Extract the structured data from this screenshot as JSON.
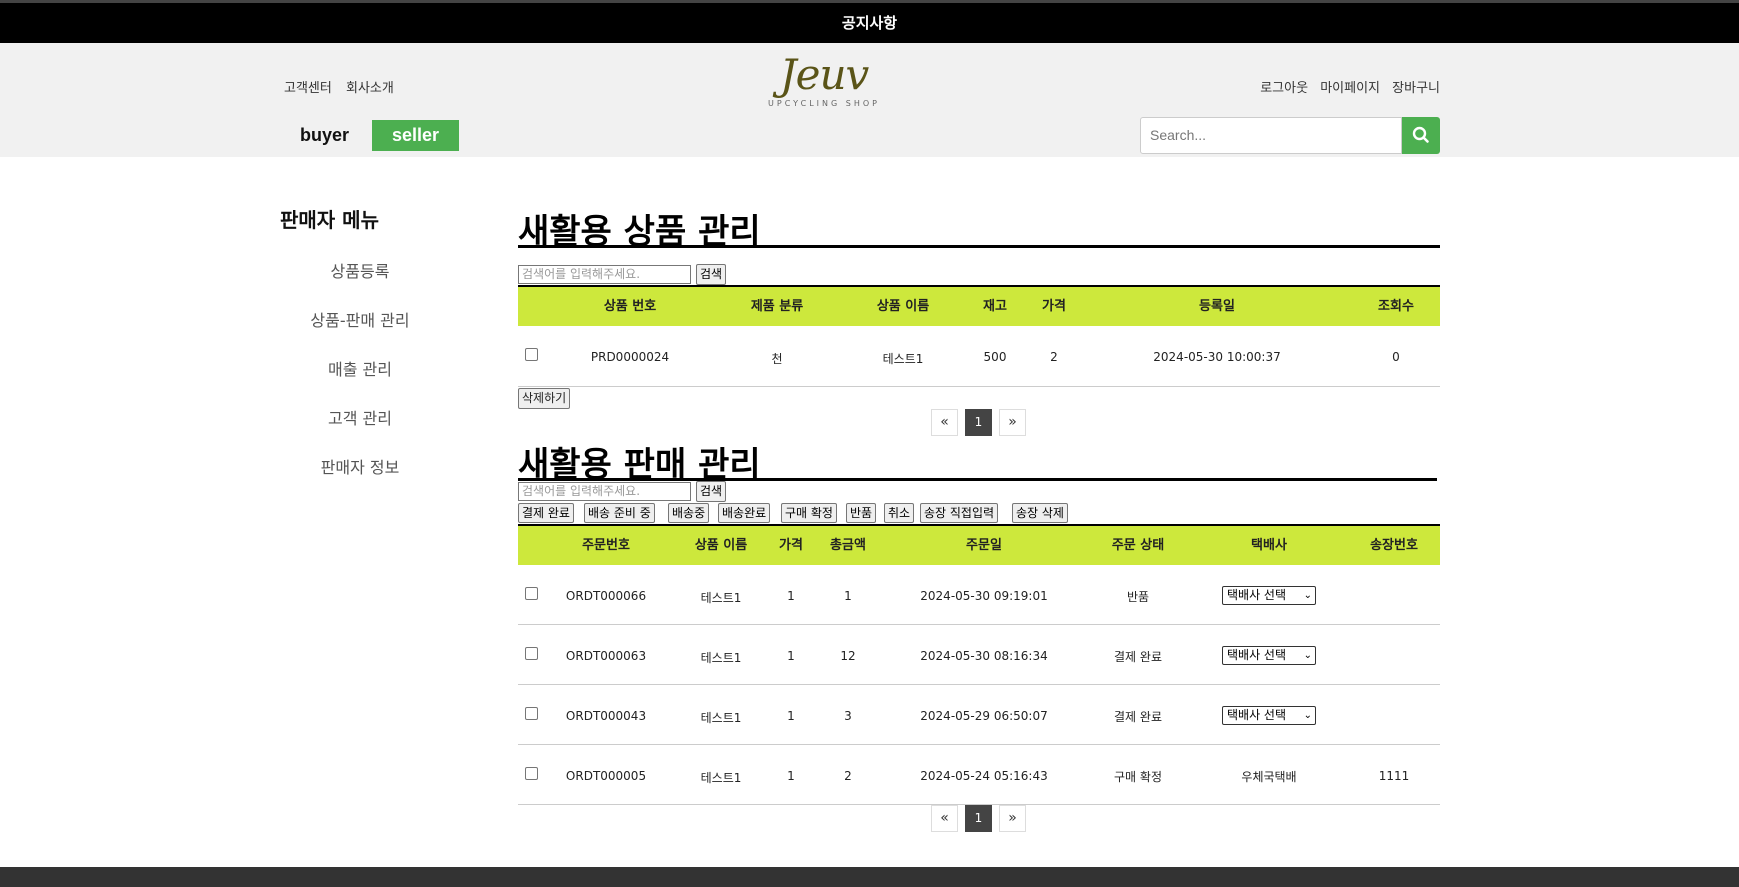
{
  "notice_bar": {
    "label": "공지사항"
  },
  "header": {
    "left_links": [
      "고객센터",
      "회사소개"
    ],
    "right_links": [
      "로그아웃",
      "마이페이지",
      "장바구니"
    ],
    "logo": {
      "word": "Jeuv",
      "sub": "UPCYCLING SHOP"
    },
    "mode_buyer": "buyer",
    "mode_seller": "seller",
    "search_placeholder": "Search...",
    "accent": "#4caf50"
  },
  "sidebar": {
    "title": "판매자 메뉴",
    "items": [
      "상품등록",
      "상품-판매 관리",
      "매출 관리",
      "고객 관리",
      "판매자 정보"
    ]
  },
  "products": {
    "title": "새활용 상품 관리",
    "search_placeholder": "검색어를 입력해주세요.",
    "search_button": "검색",
    "columns": [
      "상품 번호",
      "제품 분류",
      "상품 이름",
      "재고",
      "가격",
      "등록일",
      "조회수"
    ],
    "rows": [
      {
        "id": "PRD0000024",
        "category": "천",
        "name": "테스트1",
        "stock": "500",
        "price": "2",
        "date": "2024-05-30 10:00:37",
        "views": "0"
      }
    ],
    "delete_button": "삭제하기",
    "pager": {
      "prev": "«",
      "page": "1",
      "next": "»"
    },
    "header_color": "#cde83c"
  },
  "orders": {
    "title": "새활용 판매 관리",
    "search_placeholder": "검색어를 입력해주세요.",
    "search_button": "검색",
    "actions": [
      "결제 완료",
      "배송 준비 중",
      "배송중",
      "배송완료",
      "구매 확정",
      "반품",
      "취소",
      "송장 직접입력",
      "송장 삭제"
    ],
    "columns": [
      "주문번호",
      "상품 이름",
      "가격",
      "총금액",
      "주문일",
      "주문 상태",
      "택배사",
      "송장번호"
    ],
    "rows": [
      {
        "id": "ORDT000066",
        "name": "테스트1",
        "price": "1",
        "total": "1",
        "date": "2024-05-30 09:19:01",
        "status": "반품",
        "courier": "택배사 선택",
        "courier_select": true,
        "tracking": ""
      },
      {
        "id": "ORDT000063",
        "name": "테스트1",
        "price": "1",
        "total": "12",
        "date": "2024-05-30 08:16:34",
        "status": "결제 완료",
        "courier": "택배사 선택",
        "courier_select": true,
        "tracking": ""
      },
      {
        "id": "ORDT000043",
        "name": "테스트1",
        "price": "1",
        "total": "3",
        "date": "2024-05-29 06:50:07",
        "status": "결제 완료",
        "courier": "택배사 선택",
        "courier_select": true,
        "tracking": ""
      },
      {
        "id": "ORDT000005",
        "name": "테스트1",
        "price": "1",
        "total": "2",
        "date": "2024-05-24 05:16:43",
        "status": "구매 확정",
        "courier": "우체국택배",
        "courier_select": false,
        "tracking": "1111"
      }
    ],
    "pager": {
      "prev": "«",
      "page": "1",
      "next": "»"
    }
  }
}
